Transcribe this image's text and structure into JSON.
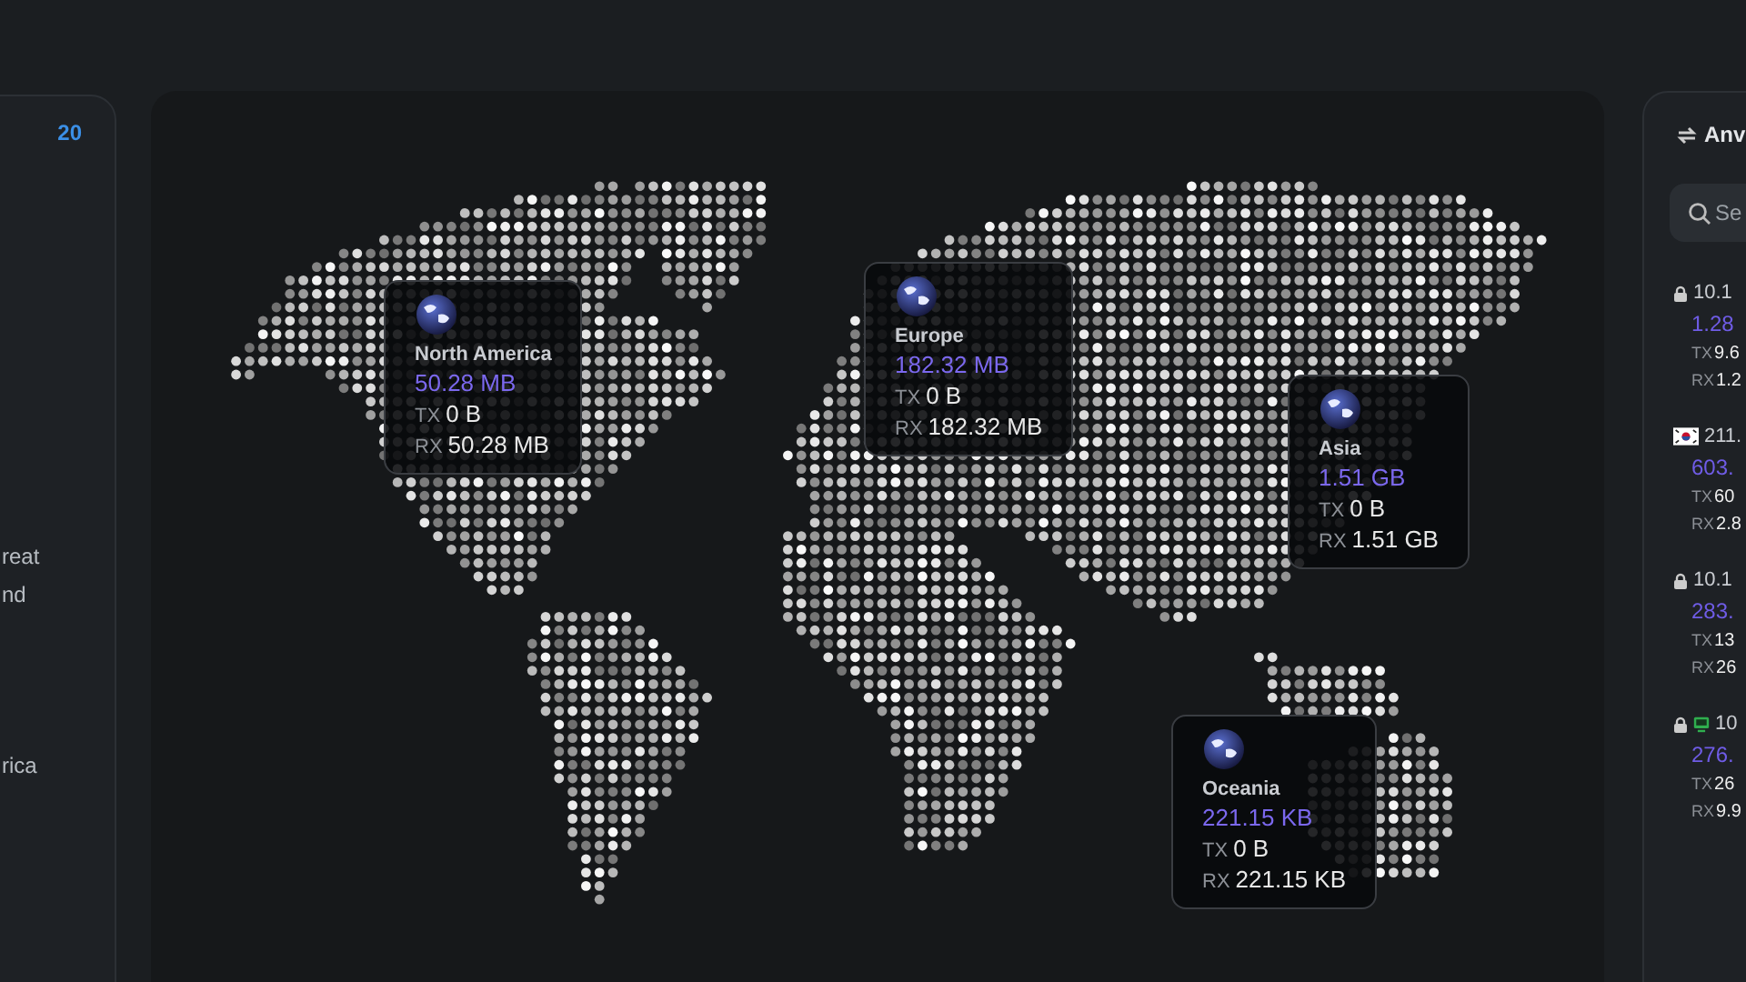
{
  "left_panel": {
    "count": "20",
    "texts": [
      "reat",
      "nd",
      "rica"
    ]
  },
  "map": {
    "regions": [
      {
        "name": "North America",
        "total": "50.28 MB",
        "tx_label": "TX",
        "tx": "0 B",
        "rx_label": "RX",
        "rx": "50.28 MB"
      },
      {
        "name": "Europe",
        "total": "182.32 MB",
        "tx_label": "TX",
        "tx": "0 B",
        "rx_label": "RX",
        "rx": "182.32 MB"
      },
      {
        "name": "Asia",
        "total": "1.51 GB",
        "tx_label": "TX",
        "tx": "0 B",
        "rx_label": "RX",
        "rx": "1.51 GB"
      },
      {
        "name": "Oceania",
        "total": "221.15 KB",
        "tx_label": "TX",
        "tx": "0 B",
        "rx_label": "RX",
        "rx": "221.15 KB"
      }
    ]
  },
  "right_panel": {
    "title": "Anv",
    "search": {
      "placeholder": "Se"
    },
    "connections": [
      {
        "kind": "lock",
        "address": "10.1",
        "total": "1.28",
        "tx_label": "TX",
        "tx": "9.6",
        "rx_label": "RX",
        "rx": "1.2"
      },
      {
        "kind": "flag",
        "address": "211.",
        "total": "603.",
        "tx_label": "TX",
        "tx": "60",
        "rx_label": "RX",
        "rx": "2.8"
      },
      {
        "kind": "lock",
        "address": "10.1",
        "total": "283.",
        "tx_label": "TX",
        "tx": "13",
        "rx_label": "RX",
        "rx": "26"
      },
      {
        "kind": "lock-device",
        "address": "10",
        "total": "276.",
        "tx_label": "TX",
        "tx": "26",
        "rx_label": "RX",
        "rx": "9.9"
      }
    ]
  }
}
